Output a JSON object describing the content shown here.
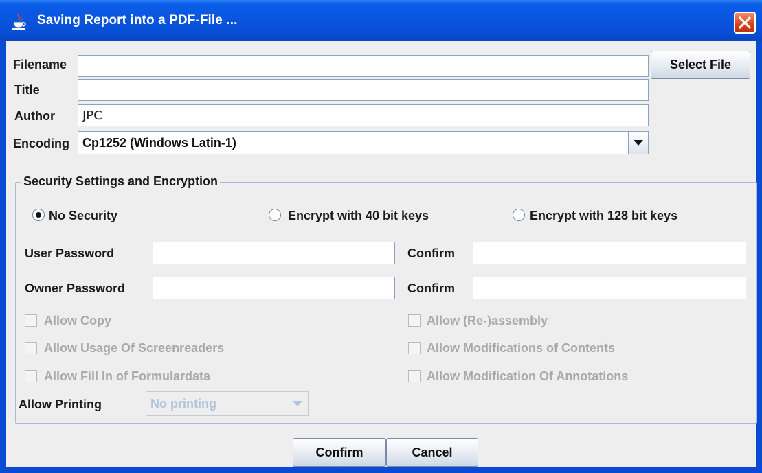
{
  "window": {
    "title": "Saving Report into a PDF-File ..."
  },
  "form": {
    "filename_label": "Filename",
    "filename_value": "",
    "title_label": "Title",
    "title_value": "",
    "author_label": "Author",
    "author_value": "JPC",
    "encoding_label": "Encoding",
    "encoding_value": "Cp1252 (Windows Latin-1)",
    "select_file_label": "Select File"
  },
  "security": {
    "group_title": "Security Settings and Encryption",
    "radio_options": [
      {
        "label": "No Security",
        "selected": true
      },
      {
        "label": "Encrypt with 40 bit keys",
        "selected": false
      },
      {
        "label": "Encrypt with 128 bit keys",
        "selected": false
      }
    ],
    "user_password_label": "User Password",
    "owner_password_label": "Owner Password",
    "confirm_label": "Confirm",
    "checkboxes": [
      {
        "label": "Allow Copy",
        "checked": false,
        "enabled": false
      },
      {
        "label": "Allow (Re-)assembly",
        "checked": false,
        "enabled": false
      },
      {
        "label": "Allow Usage Of Screenreaders",
        "checked": false,
        "enabled": false
      },
      {
        "label": "Allow Modifications of Contents",
        "checked": false,
        "enabled": false
      },
      {
        "label": "Allow Fill In of Formulardata",
        "checked": false,
        "enabled": false
      },
      {
        "label": "Allow Modification Of Annotations",
        "checked": false,
        "enabled": false
      }
    ],
    "allow_printing_label": "Allow Printing",
    "allow_printing_value": "No printing"
  },
  "buttons": {
    "confirm": "Confirm",
    "cancel": "Cancel"
  },
  "colors": {
    "titlebar": "#0a56df",
    "client_bg": "#eeeeee",
    "close_button": "#d4401c",
    "disabled_text": "#a9a9a9"
  },
  "icons": {
    "app_icon": "java-coffee-cup-icon",
    "close_icon": "close-x-icon",
    "dropdown_icon": "chevron-down-icon"
  }
}
